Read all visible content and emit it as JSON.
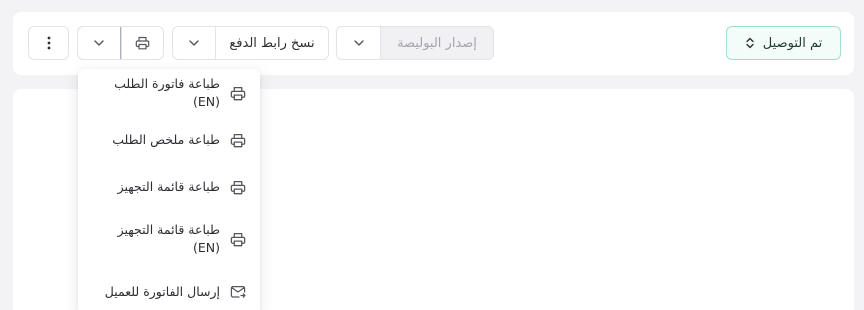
{
  "toolbar": {
    "status_label": "تم التوصيل",
    "issue_policy_label": "إصدار البوليصة",
    "copy_payment_link_label": "نسخ رابط الدفع"
  },
  "print_menu": {
    "items": [
      {
        "label": "طباعة فاتورة الطلب (EN)",
        "icon": "printer-icon"
      },
      {
        "label": "طباعة ملخص الطلب",
        "icon": "printer-icon"
      },
      {
        "label": "طباعة قائمة التجهيز",
        "icon": "printer-icon"
      },
      {
        "label": "طباعة قائمة التجهيز (EN)",
        "icon": "printer-icon"
      },
      {
        "label": "إرسال الفاتورة للعميل",
        "icon": "send-mail-icon"
      }
    ]
  },
  "colors": {
    "accent_border": "#9fe1c7",
    "page_background": "#f3f3f5"
  }
}
